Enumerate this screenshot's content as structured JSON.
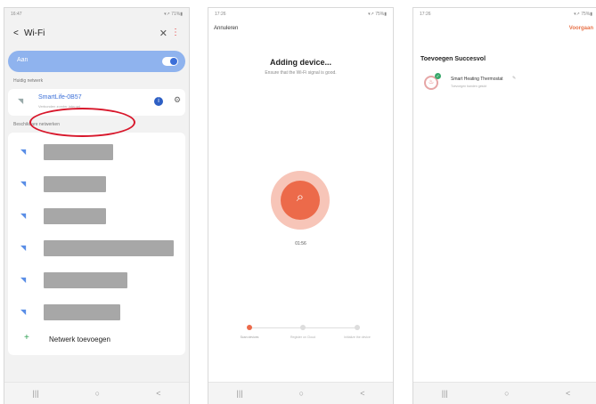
{
  "phone1": {
    "status_time": "16:47",
    "status_right": "▾↗ 71%▮",
    "header": {
      "back": "<",
      "title": "Wi-Fi",
      "close": "✕",
      "more": "⋮"
    },
    "toggle_label": "Aan",
    "current_label": "Huidig netwerk",
    "current_network": {
      "name": "SmartLife-0B57",
      "status": "Verbonden zonder internet"
    },
    "available_label": "Beschikbare netwerken",
    "add_network": {
      "plus": "+",
      "label": "Netwerk toevoegen"
    },
    "nav": [
      "|||",
      "○",
      "<"
    ]
  },
  "phone2": {
    "status_time": "17:26",
    "status_right": "▾↗ 75%▮",
    "cancel": "Annuleren",
    "title": "Adding device...",
    "subtitle": "Ensure that the Wi-Fi signal is good.",
    "search_icon": "⌕",
    "timer": "01:56",
    "steps": [
      {
        "label": "Scan devices",
        "active": true
      },
      {
        "label": "Register on Cloud",
        "active": false
      },
      {
        "label": "Initialize the device",
        "active": false
      }
    ],
    "nav": [
      "|||",
      "○",
      "<"
    ]
  },
  "phone3": {
    "status_time": "17:26",
    "status_right": "▾↗ 75%▮",
    "done": "Voorgaan",
    "title": "Toevoegen Succesvol",
    "device": {
      "name": "Smart Heating Thermostat",
      "subtitle": "Toevoegen banden gelukt",
      "edit_icon": "✎"
    },
    "nav": [
      "|||",
      "○",
      "<"
    ]
  },
  "icons": {
    "wifi": "◥",
    "check": "✓",
    "info": "i",
    "gear": "⚙",
    "thermostat": "♨"
  },
  "colors": {
    "accent_blue": "#3b6fd8",
    "toggle_bg": "#8fb3ee",
    "highlight_red": "#d8182c",
    "search_orange": "#ec6a4a",
    "success_green": "#39a86b"
  }
}
